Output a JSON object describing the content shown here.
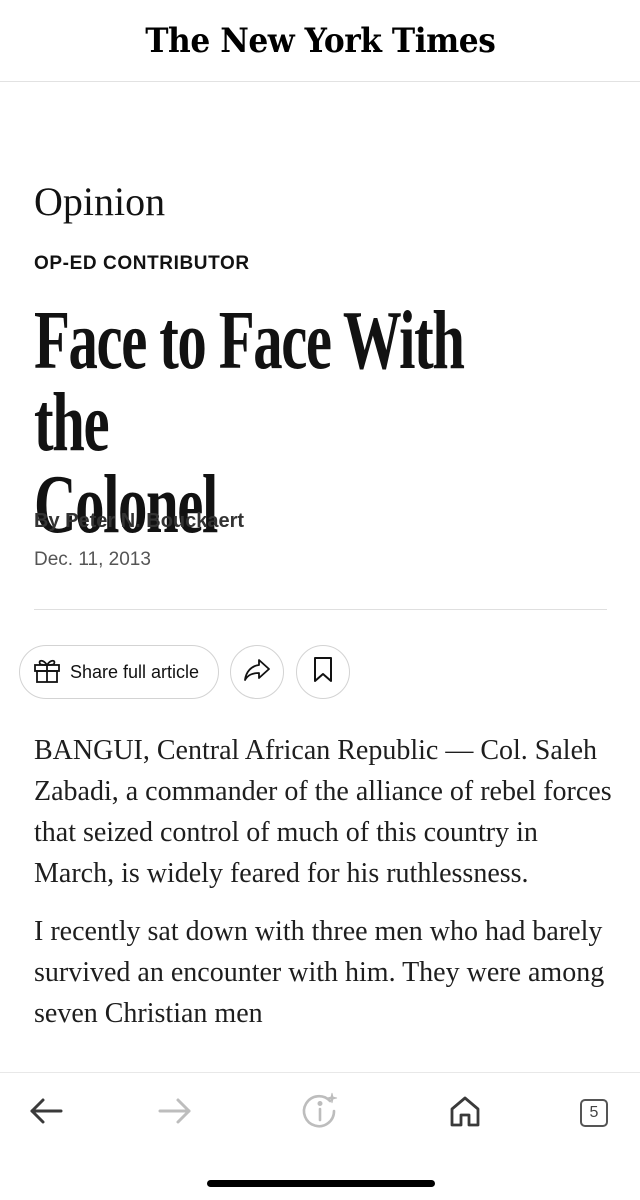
{
  "masthead": {
    "logo": "The New York Times"
  },
  "article": {
    "section": "Opinion",
    "kicker": "OP-ED CONTRIBUTOR",
    "headline_line1": "Face to Face With the",
    "headline_line2": "Colonel",
    "byline": "By Peter N. Bouckaert",
    "date": "Dec. 11, 2013",
    "paragraphs": [
      "BANGUI, Central African Republic — Col. Saleh Zabadi, a commander of the alliance of rebel forces that seized control of much of this country in March, is widely feared for his ruthlessness.",
      "I recently sat down with three men who had barely survived an encounter with him. They were among seven Christian men"
    ]
  },
  "actions": {
    "share_label": "Share full article"
  },
  "browser": {
    "tab_count": "5"
  },
  "icons": {
    "share": "gift-icon",
    "forward": "share-arrow-icon",
    "save": "bookmark-icon",
    "back": "arrow-left-icon",
    "next": "arrow-right-icon",
    "info": "info-sparkle-icon",
    "home": "home-icon"
  },
  "colors": {
    "text": "#121212",
    "border": "#d3d3d3",
    "muted_icon": "#bdbdbd"
  }
}
